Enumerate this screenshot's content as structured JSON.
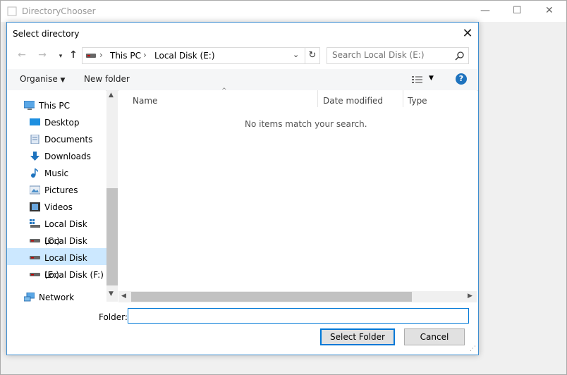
{
  "outer_window": {
    "title": "DirectoryChooser",
    "minimize": "—",
    "maximize": "☐",
    "close": "✕"
  },
  "dialog": {
    "title": "Select directory",
    "close": "✕"
  },
  "address": {
    "back": "←",
    "forward": "→",
    "up": "↑",
    "breadcrumb": [
      "This PC",
      "Local Disk (E:)"
    ],
    "separator": "›",
    "search_placeholder": "Search Local Disk (E:)"
  },
  "toolbar": {
    "organise": "Organise",
    "new_folder": "New folder",
    "help": "?"
  },
  "nav": {
    "items": [
      {
        "label": "This PC",
        "icon": "pc-icon",
        "level": 0
      },
      {
        "label": "Desktop",
        "icon": "desktop-icon",
        "level": 1
      },
      {
        "label": "Documents",
        "icon": "documents-icon",
        "level": 1
      },
      {
        "label": "Downloads",
        "icon": "downloads-icon",
        "level": 1
      },
      {
        "label": "Music",
        "icon": "music-icon",
        "level": 1
      },
      {
        "label": "Pictures",
        "icon": "pictures-icon",
        "level": 1
      },
      {
        "label": "Videos",
        "icon": "videos-icon",
        "level": 1
      },
      {
        "label": "Local Disk (C:)",
        "icon": "drive-icon",
        "level": 1
      },
      {
        "label": "Local Disk (D:)",
        "icon": "drive-icon",
        "level": 1
      },
      {
        "label": "Local Disk (E:)",
        "icon": "drive-icon",
        "level": 1,
        "selected": true
      },
      {
        "label": "Local Disk (F:)",
        "icon": "drive-icon",
        "level": 1
      },
      {
        "label": "Network",
        "icon": "network-icon",
        "level": 0
      }
    ]
  },
  "filelist": {
    "columns": [
      "Name",
      "Date modified",
      "Type"
    ],
    "empty_message": "No items match your search."
  },
  "footer": {
    "folder_label": "Folder:",
    "folder_value": "",
    "select_button": "Select Folder",
    "cancel_button": "Cancel"
  },
  "colors": {
    "accent": "#0078d7",
    "selected_row": "#cce8ff",
    "help": "#1e73be"
  }
}
